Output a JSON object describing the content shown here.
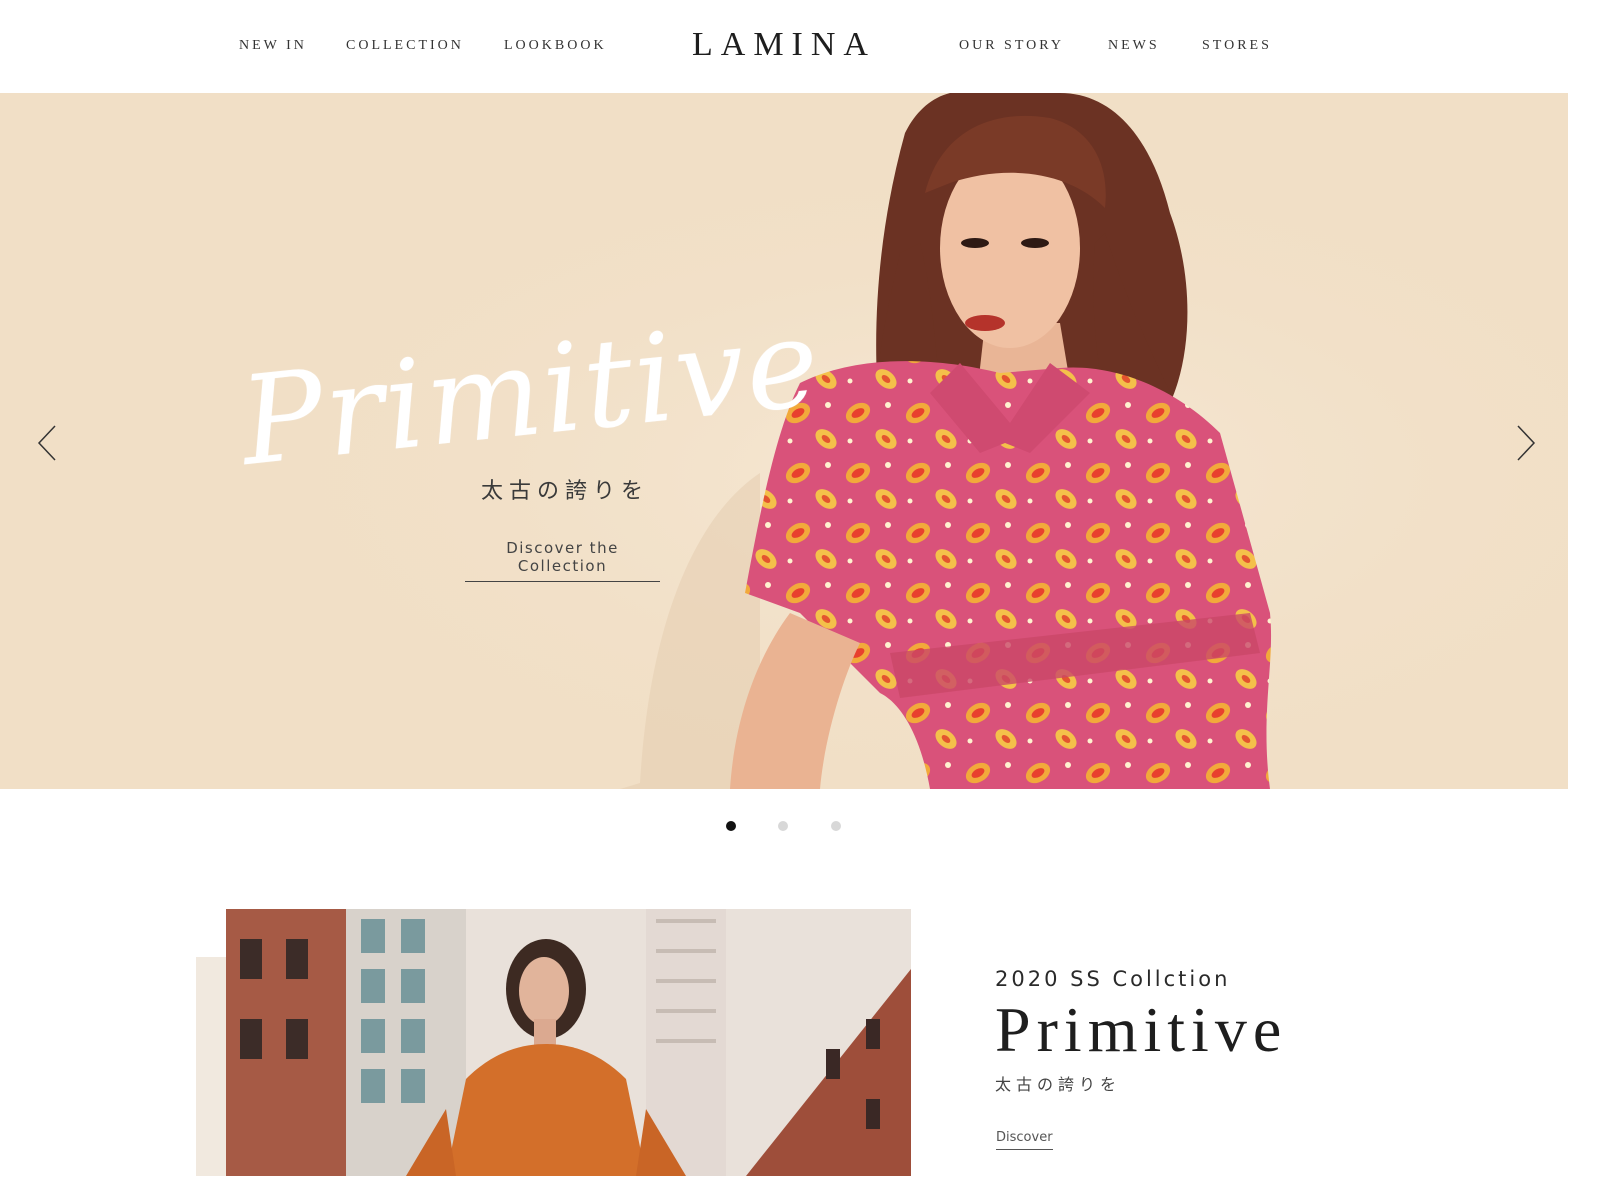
{
  "brand": {
    "name": "LAMINA"
  },
  "nav": {
    "left": [
      "NEW IN",
      "COLLECTION",
      "LOOKBOOK"
    ],
    "right": [
      "OUR STORY",
      "NEWS",
      "STORES"
    ]
  },
  "hero": {
    "script_title": "Primitive",
    "subtitle": "太古の誇りを",
    "cta": "Discover the Collection",
    "prev_icon": "chevron-left-icon",
    "next_icon": "chevron-right-icon",
    "background_color": "#f1dfc6",
    "slides_total": 3,
    "active_slide": 1
  },
  "colors": {
    "dot_active": "#111111",
    "dot_inactive": "#d8d8d8"
  },
  "feature": {
    "season": "2020 SS Collction",
    "title": "Primitive",
    "subtitle": "太古の誇りを",
    "cta": "Discover"
  }
}
